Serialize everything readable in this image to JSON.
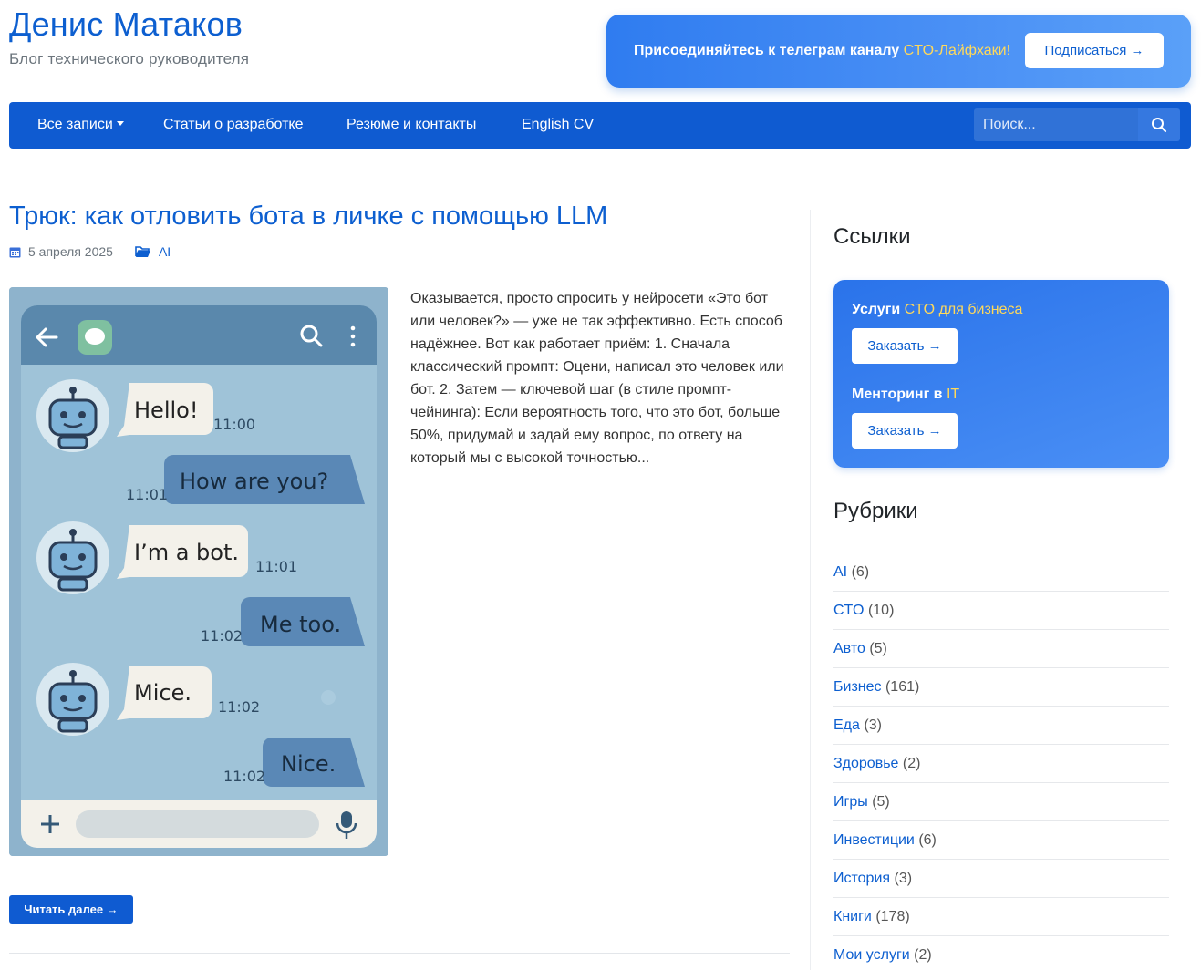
{
  "header": {
    "site_title": "Денис Матаков",
    "site_subtitle": "Блог технического руководителя"
  },
  "telegram_banner": {
    "text": "Присоединяйтесь к телеграм каналу ",
    "highlight": "CTO-Лайфхаки!",
    "button": "Подписаться →"
  },
  "nav": {
    "items": [
      "Все записи",
      "Статьи о разработке",
      "Резюме и контакты",
      "English CV"
    ],
    "search_placeholder": "Поиск..."
  },
  "post": {
    "title": "Трюк: как отловить бота в личке с помощью LLM",
    "date": "5 апреля 2025",
    "category": "AI",
    "excerpt": "Оказывается, просто спросить у нейросети «Это бот или человек?» — уже не так эффективно. Есть способ надёжнее. Вот как работает приём: 1. Сначала классический промпт:   Оцени, написал это человек или бот. 2. Затем — ключевой шаг (в стиле промпт-чейнинга):   Если вероятность того, что это бот, больше 50%, придумай и задай ему вопрос, по ответу на который мы с высокой точностью...",
    "read_more": "Читать далее →",
    "chat": [
      {
        "text": "Hello!",
        "time": "11:00",
        "side": "left"
      },
      {
        "text": "How are you?",
        "time": "11:01",
        "side": "right"
      },
      {
        "text": "I’m a bot.",
        "time": "11:01",
        "side": "left"
      },
      {
        "text": "Me too.",
        "time": "11:02",
        "side": "right"
      },
      {
        "text": "Mice.",
        "time": "11:02",
        "side": "left"
      },
      {
        "text": "Nice.",
        "time": "11:02",
        "side": "right"
      }
    ]
  },
  "sidebar": {
    "links_title": "Ссылки",
    "services": [
      {
        "label": "Услуги ",
        "highlight": "CTO для бизнеса",
        "button": "Заказать →"
      },
      {
        "label": "Менторинг в ",
        "highlight": "IT",
        "button": "Заказать →"
      }
    ],
    "categories_title": "Рубрики",
    "categories": [
      {
        "name": "AI",
        "count": "(6)"
      },
      {
        "name": "CTO",
        "count": "(10)"
      },
      {
        "name": "Авто",
        "count": "(5)"
      },
      {
        "name": "Бизнес",
        "count": "(161)"
      },
      {
        "name": "Еда",
        "count": "(3)"
      },
      {
        "name": "Здоровье",
        "count": "(2)"
      },
      {
        "name": "Игры",
        "count": "(5)"
      },
      {
        "name": "Инвестиции",
        "count": "(6)"
      },
      {
        "name": "История",
        "count": "(3)"
      },
      {
        "name": "Книги",
        "count": "(178)"
      },
      {
        "name": "Мои услуги",
        "count": "(2)"
      }
    ]
  },
  "colors": {
    "brand": "#0f5bd1",
    "link": "#0d5fd0",
    "highlight": "#ffd95a"
  }
}
